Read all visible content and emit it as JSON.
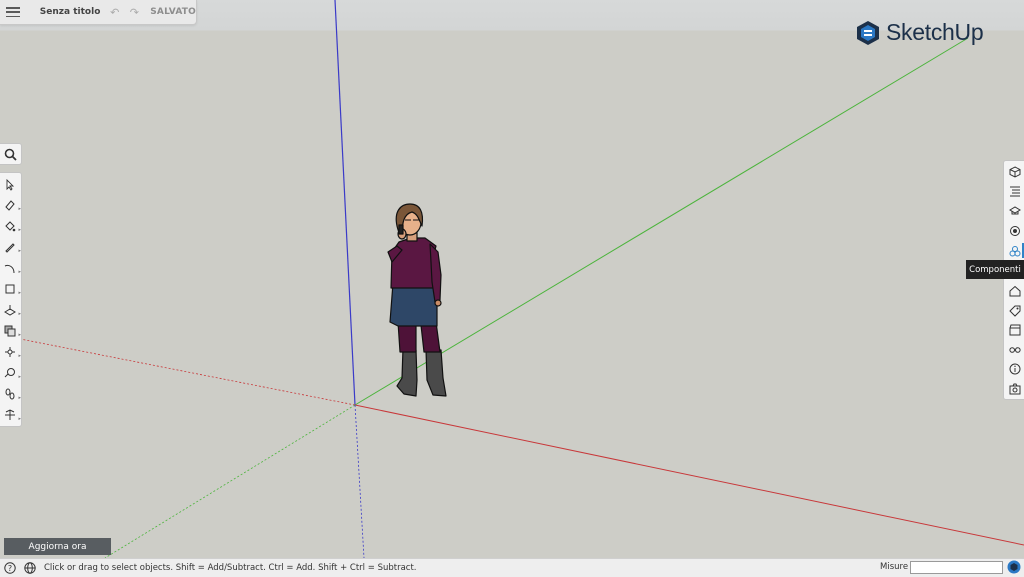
{
  "app": {
    "brand": "SketchUp",
    "document_title": "Senza titolo",
    "save_status": "SALVATO"
  },
  "toolbar": {
    "undo_icon": "undo-icon",
    "redo_icon": "redo-icon"
  },
  "left_tools": [
    "search",
    "select",
    "eraser",
    "paint-bucket",
    "pencil",
    "arc",
    "rectangle",
    "push-pull",
    "offset",
    "move",
    "tape-measure",
    "walk",
    "orbit"
  ],
  "right_panels": [
    "entity-info",
    "outliner",
    "instructor",
    "materials",
    "components",
    "styles",
    "tags",
    "scenes",
    "display",
    "model-info",
    "export"
  ],
  "tooltip": {
    "text": "Componenti"
  },
  "update_button": {
    "label": "Aggiorna ora"
  },
  "status": {
    "message": "Click or drag to select objects. Shift = Add/Subtract. Ctrl = Add. Shift + Ctrl = Subtract.",
    "measure_label": "Misure",
    "measure_value": ""
  },
  "colors": {
    "axis_red": "#c8383a",
    "axis_green": "#4cb43c",
    "axis_blue": "#3a3ac8",
    "accent": "#2f83c7",
    "logo": "#1c3049"
  }
}
